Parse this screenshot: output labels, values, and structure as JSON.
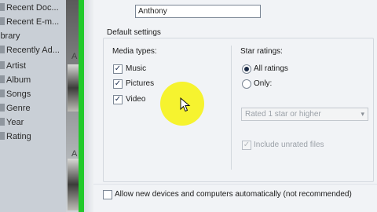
{
  "sidebar": {
    "items": [
      {
        "label": "Recent Doc..."
      },
      {
        "label": "Recent E-m..."
      },
      {
        "label": "ibrary"
      },
      {
        "label": "Recently Ad..."
      },
      {
        "label": "Artist"
      },
      {
        "label": "Album"
      },
      {
        "label": "Songs"
      },
      {
        "label": "Genre"
      },
      {
        "label": "Year"
      },
      {
        "label": "Rating"
      }
    ],
    "thumb_letters": [
      "A",
      "A"
    ]
  },
  "name_field": {
    "value": "Anthony"
  },
  "default_settings": {
    "title": "Default settings",
    "media_types": {
      "label": "Media types:",
      "items": [
        {
          "label": "Music",
          "checked": true
        },
        {
          "label": "Pictures",
          "checked": true
        },
        {
          "label": "Video",
          "checked": true
        }
      ]
    },
    "star_ratings": {
      "label": "Star ratings:",
      "all_label": "All ratings",
      "only_label": "Only:",
      "selected": "All ratings",
      "select_value": "Rated 1 star or higher",
      "include_unrated_label": "Include unrated files",
      "include_unrated_checked": true
    }
  },
  "allow_devices": {
    "label": "Allow new devices and computers automatically (not recommended)",
    "checked": false
  },
  "colors": {
    "green_bar": "#21c92a",
    "highlight": "#f5f224"
  }
}
